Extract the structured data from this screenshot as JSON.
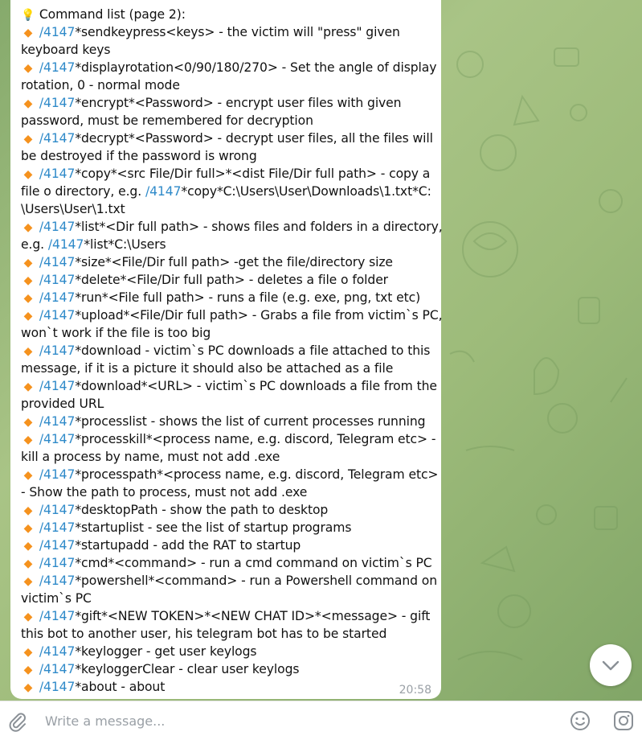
{
  "colors": {
    "command_link": "#2f8ac9",
    "bullet": "#f5921e",
    "bulb": "#f0c419",
    "timestamp": "#9aa0a6"
  },
  "message": {
    "lines": [
      {
        "icon": "lightbulb-icon",
        "parts": [
          {
            "t": "Command list (page 2):"
          }
        ]
      },
      {
        "icon": "orange-diamond-icon",
        "parts": [
          {
            "t": "/4147",
            "c": 1
          },
          {
            "t": "*sendkeypress<keys> - the victim will \"press\" given"
          }
        ]
      },
      {
        "parts": [
          {
            "t": "keyboard keys"
          }
        ]
      },
      {
        "icon": "orange-diamond-icon",
        "parts": [
          {
            "t": "/4147",
            "c": 1
          },
          {
            "t": "*displayrotation<0/90/180/270> - Set the angle of display"
          }
        ]
      },
      {
        "parts": [
          {
            "t": "rotation, 0 - normal mode"
          }
        ]
      },
      {
        "icon": "orange-diamond-icon",
        "parts": [
          {
            "t": "/4147",
            "c": 1
          },
          {
            "t": "*encrypt*<Password> - encrypt user files with given"
          }
        ]
      },
      {
        "parts": [
          {
            "t": "password, must be remembered for decryption"
          }
        ]
      },
      {
        "icon": "orange-diamond-icon",
        "parts": [
          {
            "t": "/4147",
            "c": 1
          },
          {
            "t": "*decrypt*<Password> - decrypt user files, all the files will"
          }
        ]
      },
      {
        "parts": [
          {
            "t": "be destroyed if the password is wrong"
          }
        ]
      },
      {
        "icon": "orange-diamond-icon",
        "parts": [
          {
            "t": "/4147",
            "c": 1
          },
          {
            "t": "*copy*<src File/Dir full>*<dist File/Dir full path>  - copy a"
          }
        ]
      },
      {
        "parts": [
          {
            "t": "file o directory, e.g. "
          },
          {
            "t": "/4147",
            "c": 1
          },
          {
            "t": "*copy*C:\\Users\\User\\Downloads\\1.txt*C:"
          }
        ]
      },
      {
        "parts": [
          {
            "t": "\\Users\\User\\1.txt"
          }
        ]
      },
      {
        "icon": "orange-diamond-icon",
        "parts": [
          {
            "t": "/4147",
            "c": 1
          },
          {
            "t": "*list*<Dir full path> - shows files and folders in a directory,"
          }
        ]
      },
      {
        "parts": [
          {
            "t": "e.g. "
          },
          {
            "t": "/4147",
            "c": 1
          },
          {
            "t": "*list*C:\\Users"
          }
        ]
      },
      {
        "icon": "orange-diamond-icon",
        "parts": [
          {
            "t": "/4147",
            "c": 1
          },
          {
            "t": "*size*<File/Dir full path> -get the file/directory size"
          }
        ]
      },
      {
        "icon": "orange-diamond-icon",
        "parts": [
          {
            "t": "/4147",
            "c": 1
          },
          {
            "t": "*delete*<File/Dir full path> - deletes a file o folder"
          }
        ]
      },
      {
        "icon": "orange-diamond-icon",
        "parts": [
          {
            "t": "/4147",
            "c": 1
          },
          {
            "t": "*run*<File full path> - runs a file (e.g. exe, png, txt etc)"
          }
        ]
      },
      {
        "icon": "orange-diamond-icon",
        "parts": [
          {
            "t": "/4147",
            "c": 1
          },
          {
            "t": "*upload*<File/Dir full path> - Grabs a file from victim`s PC,"
          }
        ]
      },
      {
        "parts": [
          {
            "t": "won`t work if the file is too big"
          }
        ]
      },
      {
        "icon": "orange-diamond-icon",
        "parts": [
          {
            "t": "/4147",
            "c": 1
          },
          {
            "t": "*download - victim`s PC downloads a file attached to this"
          }
        ]
      },
      {
        "parts": [
          {
            "t": "message, if it is a picture it should also be attached as a file"
          }
        ]
      },
      {
        "icon": "orange-diamond-icon",
        "parts": [
          {
            "t": "/4147",
            "c": 1
          },
          {
            "t": "*download*<URL> - victim`s PC downloads a file from the"
          }
        ]
      },
      {
        "parts": [
          {
            "t": "provided URL"
          }
        ]
      },
      {
        "icon": "orange-diamond-icon",
        "parts": [
          {
            "t": "/4147",
            "c": 1
          },
          {
            "t": "*processlist - shows the list of current processes running"
          }
        ]
      },
      {
        "icon": "orange-diamond-icon",
        "parts": [
          {
            "t": "/4147",
            "c": 1
          },
          {
            "t": "*processkill*<process name, e.g. discord, Telegram etc> -"
          }
        ]
      },
      {
        "parts": [
          {
            "t": "kill a process by name, must not add .exe"
          }
        ]
      },
      {
        "icon": "orange-diamond-icon",
        "parts": [
          {
            "t": "/4147",
            "c": 1
          },
          {
            "t": "*processpath*<process name, e.g. discord, Telegram etc>"
          }
        ]
      },
      {
        "parts": [
          {
            "t": "- Show the path to process, must not add .exe"
          }
        ]
      },
      {
        "icon": "orange-diamond-icon",
        "parts": [
          {
            "t": "/4147",
            "c": 1
          },
          {
            "t": "*desktopPath - show the path to desktop"
          }
        ]
      },
      {
        "icon": "orange-diamond-icon",
        "parts": [
          {
            "t": "/4147",
            "c": 1
          },
          {
            "t": "*startuplist - see the list of startup programs"
          }
        ]
      },
      {
        "icon": "orange-diamond-icon",
        "parts": [
          {
            "t": "/4147",
            "c": 1
          },
          {
            "t": "*startupadd - add the RAT to startup"
          }
        ]
      },
      {
        "icon": "orange-diamond-icon",
        "parts": [
          {
            "t": "/4147",
            "c": 1
          },
          {
            "t": "*cmd*<command> - run a cmd command on victim`s PC"
          }
        ]
      },
      {
        "icon": "orange-diamond-icon",
        "parts": [
          {
            "t": "/4147",
            "c": 1
          },
          {
            "t": "*powershell*<command> - run a Powershell command on"
          }
        ]
      },
      {
        "parts": [
          {
            "t": "victim`s PC"
          }
        ]
      },
      {
        "icon": "orange-diamond-icon",
        "parts": [
          {
            "t": "/4147",
            "c": 1
          },
          {
            "t": "*gift*<NEW TOKEN>*<NEW CHAT ID>*<message> - gift"
          }
        ]
      },
      {
        "parts": [
          {
            "t": "this bot to another user, his telegram bot has to be started"
          }
        ]
      },
      {
        "icon": "orange-diamond-icon",
        "parts": [
          {
            "t": "/4147",
            "c": 1
          },
          {
            "t": "*keylogger - get user keylogs"
          }
        ]
      },
      {
        "icon": "orange-diamond-icon",
        "parts": [
          {
            "t": "/4147",
            "c": 1
          },
          {
            "t": "*keyloggerClear - clear user keylogs"
          }
        ]
      },
      {
        "icon": "orange-diamond-icon",
        "parts": [
          {
            "t": "/4147",
            "c": 1
          },
          {
            "t": "*about - about"
          }
        ]
      }
    ],
    "time": "20:58"
  },
  "composer": {
    "placeholder": "Write a message...",
    "icons": [
      "paperclip-icon",
      "emoji-icon",
      "camera-icon"
    ]
  },
  "scroll_button": {
    "icon": "chevron-down-icon"
  }
}
